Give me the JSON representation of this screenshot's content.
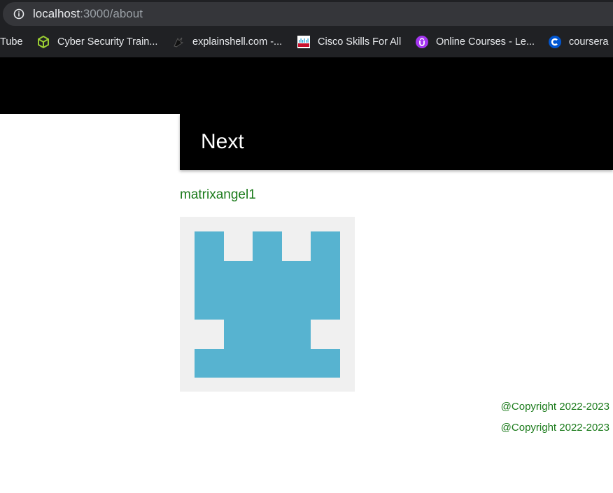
{
  "browser": {
    "url_host": "localhost",
    "url_path": ":3000/about",
    "bookmarks": [
      {
        "label": "Tube",
        "icon": "youtube-icon"
      },
      {
        "label": "Cyber Security Train...",
        "icon": "cube-icon"
      },
      {
        "label": "explainshell.com -...",
        "icon": "shell-icon"
      },
      {
        "label": "Cisco Skills For All",
        "icon": "cisco-icon"
      },
      {
        "label": "Online Courses - Le...",
        "icon": "udemy-icon"
      },
      {
        "label": "coursera",
        "icon": "coursera-icon"
      }
    ]
  },
  "page": {
    "next_label": "Next",
    "username": "matrixangel1",
    "avatar_color": "#57b3d0",
    "footer": [
      "@Copyright 2022-2023",
      "@Copyright 2022-2023"
    ]
  }
}
